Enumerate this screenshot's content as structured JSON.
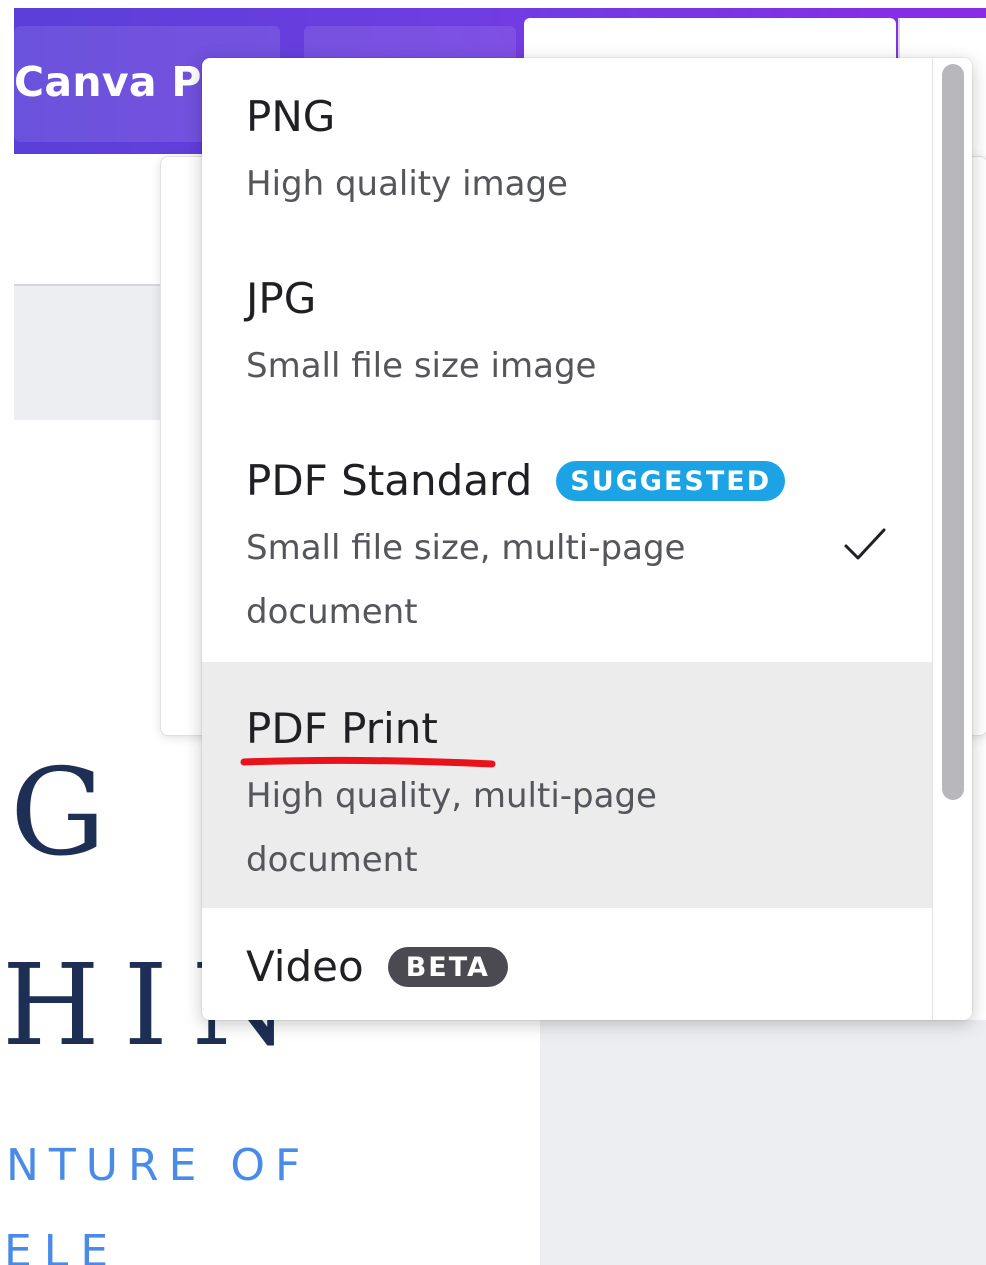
{
  "header": {
    "canva_pro_label": "Canva Pro"
  },
  "design": {
    "big_letter": "G",
    "hin_text": "HIN",
    "line_one": "NTURE OF",
    "line_two": "ELE"
  },
  "download_menu": {
    "options": [
      {
        "title": "PNG",
        "description": "High quality image"
      },
      {
        "title": "JPG",
        "description": "Small file size image"
      },
      {
        "title": "PDF Standard",
        "badge": "SUGGESTED",
        "description": "Small file size, multi-page document",
        "selected": true
      },
      {
        "title": "PDF Print",
        "description": "High quality, multi-page document",
        "hovered": true
      },
      {
        "title": "Video",
        "badge": "BETA"
      }
    ]
  },
  "colors": {
    "header_start": "#5a3fd8",
    "header_end": "#8a2be6",
    "suggested_badge": "#1ba3e6",
    "beta_badge": "#4a4a50",
    "hover_row": "#ececed",
    "annotation_underline": "#e8121b",
    "design_navy": "#1e2f55",
    "design_blue": "#4a8be8"
  },
  "icons": {
    "selected_marker": "checkmark-icon",
    "header_dropdown": "chevron-down-icon"
  }
}
